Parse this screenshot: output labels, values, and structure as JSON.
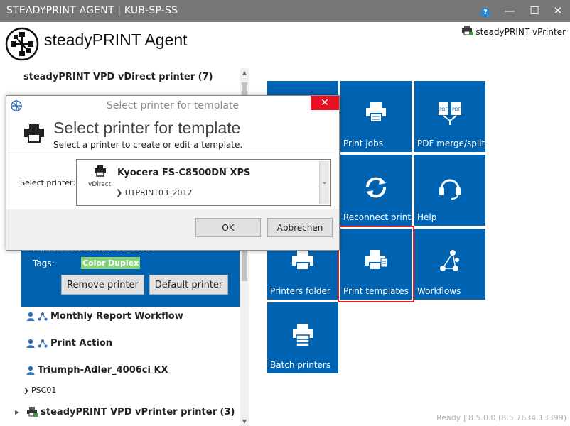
{
  "window": {
    "title": "STEADYPRINT AGENT | KUB-SP-SS",
    "help_glyph": "?",
    "minimize_glyph": "—",
    "maximize_glyph": "☐",
    "close_glyph": "✕"
  },
  "header": {
    "app_name": "steadyPRINT Agent",
    "vprinter_link": "steadyPRINT vPrinter"
  },
  "left_panel": {
    "group_top": "steadyPRINT VPD vDirect printer (7)",
    "selected_item": {
      "obscured_text": "Print server: UTPRINT03_2012",
      "tags_label": "Tags:",
      "tags": [
        "Color",
        "Duplex"
      ],
      "remove_button": "Remove printer",
      "default_button": "Default printer"
    },
    "entries": [
      {
        "label": "Monthly Report Workflow"
      },
      {
        "label": "Print Action"
      },
      {
        "label": "Triumph-Adler_4006ci KX"
      }
    ],
    "sub_entry": "PSC01",
    "group_bottom": "steadyPRINT VPD vPrinter printer (3)"
  },
  "tiles": [
    {
      "label": "Print jobs",
      "icon": "print-jobs-icon"
    },
    {
      "label": "PDF merge/split",
      "icon": "pdf-merge-icon"
    },
    {
      "label": "Reconnect print...",
      "icon": "refresh-icon"
    },
    {
      "label": "Help",
      "icon": "headset-icon"
    },
    {
      "label": "Printers folder",
      "icon": "printer-icon"
    },
    {
      "label": "Print templates",
      "icon": "print-template-icon"
    },
    {
      "label": "Workflows",
      "icon": "workflow-icon"
    },
    {
      "label": "Batch printers",
      "icon": "batch-printer-icon"
    }
  ],
  "dialog": {
    "window_title": "Select printer for template",
    "heading": "Select printer for template",
    "subheading": "Select a printer to create or edit a template.",
    "select_label": "Select printer:",
    "printer": {
      "type": "vDirect",
      "name": "Kyocera FS-C8500DN XPS",
      "server": "❯ UTPRINT03_2012"
    },
    "ok": "OK",
    "cancel": "Abbrechen",
    "close_glyph": "✕",
    "dropdown_glyph": "⌄"
  },
  "status": "Ready | 8.5.0.0 (8.5.7634.13399)",
  "colors": {
    "tile_blue": "#0063b1",
    "title_gray": "#767676",
    "tag_green": "#84d27c",
    "highlight_red": "#d9262c",
    "close_red": "#e81123"
  }
}
